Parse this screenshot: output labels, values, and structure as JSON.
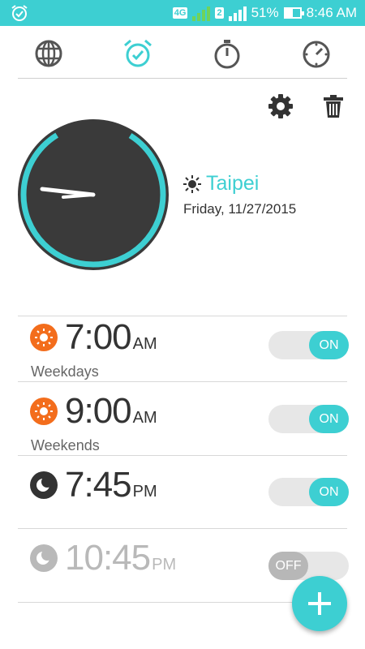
{
  "status_bar": {
    "left_icon": "alarm-icon",
    "network_badge": "4G",
    "sim2_badge": "2",
    "battery_percent": "51%",
    "time": "8:46 AM",
    "color": "#3dcfd2"
  },
  "tabs": [
    {
      "name": "world-clock",
      "icon": "globe-icon",
      "active": false
    },
    {
      "name": "alarm",
      "icon": "alarm-clock-icon",
      "active": true
    },
    {
      "name": "stopwatch",
      "icon": "stopwatch-icon",
      "active": false
    },
    {
      "name": "timer",
      "icon": "timer-icon",
      "active": false
    }
  ],
  "toolbar": {
    "settings_icon": "gear-icon",
    "delete_icon": "trash-icon"
  },
  "clock": {
    "city": "Taipei",
    "date": "Friday, 11/27/2015",
    "weather_icon": "sun-icon"
  },
  "alarms": [
    {
      "time": "7:00",
      "ampm": "AM",
      "label": "Weekdays",
      "icon": "sun-icon",
      "icon_color": "#f36d1c",
      "state": "ON",
      "enabled": true
    },
    {
      "time": "9:00",
      "ampm": "AM",
      "label": "Weekends",
      "icon": "sun-icon",
      "icon_color": "#f36d1c",
      "state": "ON",
      "enabled": true
    },
    {
      "time": "7:45",
      "ampm": "PM",
      "label": "",
      "icon": "moon-icon",
      "icon_color": "#333333",
      "state": "ON",
      "enabled": true
    },
    {
      "time": "10:45",
      "ampm": "PM",
      "label": "",
      "icon": "moon-icon",
      "icon_color": "#b9b9b9",
      "state": "OFF",
      "enabled": false
    }
  ],
  "fab": {
    "icon": "plus-icon"
  },
  "colors": {
    "accent": "#3dcfd2",
    "dark": "#333333",
    "orange": "#f36d1c"
  }
}
